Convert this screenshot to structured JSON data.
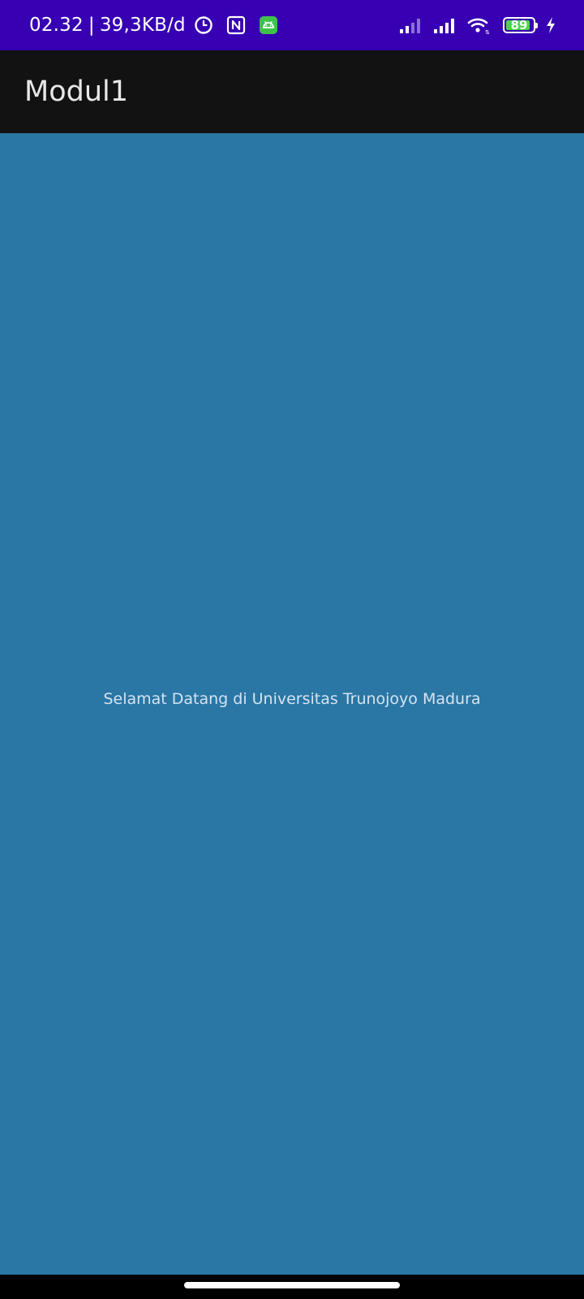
{
  "status_bar": {
    "time": "02.32",
    "separator": "|",
    "network_speed": "39,3KB/d",
    "battery_level": "89",
    "icons": {
      "alarm": "alarm-clock-icon",
      "nfc": "nfc-icon",
      "app_notification": "android-robot-icon",
      "signal_1": "signal-bars-icon",
      "signal_2": "signal-bars-icon",
      "wifi": "wifi-icon",
      "battery": "battery-icon",
      "charging": "charging-bolt-icon"
    },
    "colors": {
      "background": "#3700b3",
      "battery_fill": "#4ad44a",
      "notification_badge": "#3fc24a"
    }
  },
  "app_bar": {
    "title": "Modul1",
    "background": "#121212"
  },
  "main": {
    "welcome_text": "Selamat Datang di Universitas Trunojoyo Madura",
    "background": "#2a76a5"
  },
  "nav_bar": {
    "gesture": "home-indicator"
  }
}
